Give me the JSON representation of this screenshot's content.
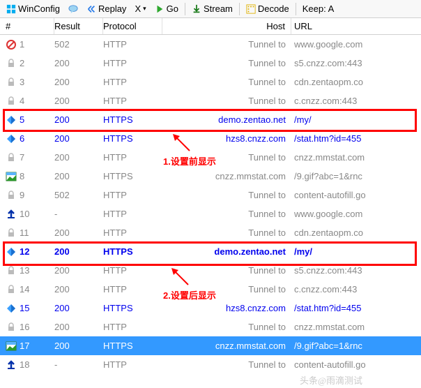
{
  "toolbar": {
    "winconfig": "WinConfig",
    "replay": "Replay",
    "x": "X",
    "go": "Go",
    "stream": "Stream",
    "decode": "Decode",
    "keep": "Keep: A"
  },
  "headers": {
    "num": "#",
    "result": "Result",
    "protocol": "Protocol",
    "host": "Host",
    "url": "URL"
  },
  "rows": [
    {
      "n": "1",
      "icon": "forbid",
      "res": "502",
      "proto": "HTTP",
      "host": "Tunnel to",
      "url": "www.google.com",
      "cls": ""
    },
    {
      "n": "2",
      "icon": "lock",
      "res": "200",
      "proto": "HTTP",
      "host": "Tunnel to",
      "url": "s5.cnzz.com:443",
      "cls": ""
    },
    {
      "n": "3",
      "icon": "lock",
      "res": "200",
      "proto": "HTTP",
      "host": "Tunnel to",
      "url": "cdn.zentaopm.co",
      "cls": ""
    },
    {
      "n": "4",
      "icon": "lock",
      "res": "200",
      "proto": "HTTP",
      "host": "Tunnel to",
      "url": "c.cnzz.com:443",
      "cls": ""
    },
    {
      "n": "5",
      "icon": "diamond",
      "res": "200",
      "proto": "HTTPS",
      "host": "demo.zentao.net",
      "url": "/my/",
      "cls": "blue"
    },
    {
      "n": "6",
      "icon": "diamond",
      "res": "200",
      "proto": "HTTPS",
      "host": "hzs8.cnzz.com",
      "url": "/stat.htm?id=455",
      "cls": "blue"
    },
    {
      "n": "7",
      "icon": "lock",
      "res": "200",
      "proto": "HTTP",
      "host": "Tunnel to",
      "url": "cnzz.mmstat.com",
      "cls": ""
    },
    {
      "n": "8",
      "icon": "image",
      "res": "200",
      "proto": "HTTPS",
      "host": "cnzz.mmstat.com",
      "url": "/9.gif?abc=1&rnc",
      "cls": ""
    },
    {
      "n": "9",
      "icon": "lock",
      "res": "502",
      "proto": "HTTP",
      "host": "Tunnel to",
      "url": "content-autofill.go",
      "cls": ""
    },
    {
      "n": "10",
      "icon": "upload",
      "res": "-",
      "proto": "HTTP",
      "host": "Tunnel to",
      "url": "www.google.com",
      "cls": ""
    },
    {
      "n": "11",
      "icon": "lock",
      "res": "200",
      "proto": "HTTP",
      "host": "Tunnel to",
      "url": "cdn.zentaopm.co",
      "cls": ""
    },
    {
      "n": "12",
      "icon": "diamond",
      "res": "200",
      "proto": "HTTPS",
      "host": "demo.zentao.net",
      "url": "/my/",
      "cls": "bblue"
    },
    {
      "n": "13",
      "icon": "lock",
      "res": "200",
      "proto": "HTTP",
      "host": "Tunnel to",
      "url": "s5.cnzz.com:443",
      "cls": ""
    },
    {
      "n": "14",
      "icon": "lock",
      "res": "200",
      "proto": "HTTP",
      "host": "Tunnel to",
      "url": "c.cnzz.com:443",
      "cls": ""
    },
    {
      "n": "15",
      "icon": "diamond",
      "res": "200",
      "proto": "HTTPS",
      "host": "hzs8.cnzz.com",
      "url": "/stat.htm?id=455",
      "cls": "blue"
    },
    {
      "n": "16",
      "icon": "lock",
      "res": "200",
      "proto": "HTTP",
      "host": "Tunnel to",
      "url": "cnzz.mmstat.com",
      "cls": ""
    },
    {
      "n": "17",
      "icon": "image",
      "res": "200",
      "proto": "HTTPS",
      "host": "cnzz.mmstat.com",
      "url": "/9.gif?abc=1&rnc",
      "cls": "sel"
    },
    {
      "n": "18",
      "icon": "upload",
      "res": "-",
      "proto": "HTTP",
      "host": "Tunnel to",
      "url": "content-autofill.go",
      "cls": ""
    }
  ],
  "annotations": {
    "label1": "1.设置前显示",
    "label2": "2.设置后显示"
  },
  "watermark": "头条@雨滴测试"
}
